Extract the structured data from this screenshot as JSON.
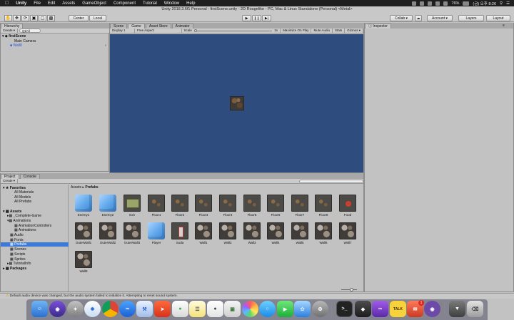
{
  "menubar": {
    "apple": "",
    "items": [
      "Unity",
      "File",
      "Edit",
      "Assets",
      "GameObject",
      "Component",
      "Tutorial",
      "Window",
      "Help"
    ],
    "battery": "76%",
    "clock": "(금) 오후 8:26"
  },
  "window": {
    "title": "Unity 2018.3.6f1 Personal - firstScene.unity - 2D Rougelike - PC, Mac & Linux Standalone (Personal) <Metal>"
  },
  "toolbar": {
    "center_label": "Center",
    "local_label": "Local",
    "collab_label": "Collab ▾",
    "account_label": "Account ▾",
    "layers_label": "Layers",
    "layout_label": "Layout"
  },
  "hierarchy": {
    "tab": "Hierarchy",
    "create": "Create ▾",
    "search_placeholder": "Q▾All",
    "scene": "firstScene",
    "items": [
      "Main Camera",
      "Wall8"
    ]
  },
  "game": {
    "tabs": [
      "Scene",
      "Game",
      "Asset Store",
      "Animator"
    ],
    "display": "Display 1",
    "aspect": "Free Aspect",
    "scale_label": "Scale",
    "scale_value": "2x",
    "toggles": [
      "Maximize On Play",
      "Mute Audio",
      "Stats",
      "Gizmos ▾"
    ]
  },
  "inspector": {
    "tab": "Inspector"
  },
  "project": {
    "tabs": [
      "Project",
      "Console"
    ],
    "create": "Create ▾",
    "favorites_title": "Favorites",
    "favorites": [
      "All Materials",
      "All Models",
      "All Prefabs"
    ],
    "assets_title": "Assets",
    "folders": [
      "_Complete-Game",
      "Animations",
      "AnimationControllers",
      "Animations",
      "Audio",
      "Fonts",
      "Prefabs",
      "Scenes",
      "Scripts",
      "Sprites",
      "TutorialInfo"
    ],
    "packages_title": "Packages",
    "breadcrumb_root": "Assets",
    "breadcrumb_sep": "▸",
    "breadcrumb_leaf": "Prefabs",
    "assets_row1": [
      "Enemy1",
      "Enemy2",
      "Exit",
      "Floor1",
      "Floor2",
      "Floor3",
      "Floor4",
      "Floor5",
      "Floor6",
      "Floor7",
      "Floor8",
      "Food"
    ],
    "assets_row2": [
      "OuterWall1",
      "OuterWall2",
      "OuterWall3",
      "Player",
      "Soda",
      "Wall1",
      "Wall2",
      "Wall3",
      "Wall4",
      "Wall5",
      "Wall6",
      "Wall7"
    ],
    "assets_row3": [
      "Wall8"
    ]
  },
  "status": {
    "message": "Default audio device was changed, but the audio system failed to initialize it. Attempting to reset sound system."
  },
  "dock": {
    "talk_label": "TALK",
    "badge": "1"
  }
}
